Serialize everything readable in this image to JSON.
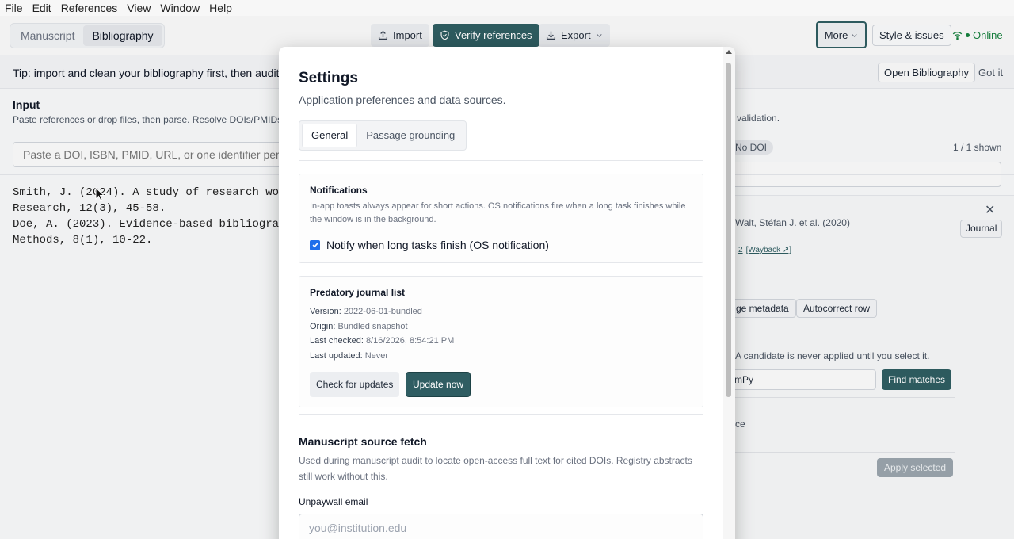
{
  "menu": [
    "File",
    "Edit",
    "References",
    "View",
    "Window",
    "Help"
  ],
  "toolbar": {
    "tabs": [
      {
        "label": "Manuscript"
      },
      {
        "label": "Bibliography"
      }
    ],
    "import_label": "Import",
    "verify_label": "Verify references",
    "export_label": "Export",
    "more_label": "More",
    "style_label": "Style & issues",
    "status_label": "Online",
    "status_color": "#15803d"
  },
  "tip": {
    "text": "Tip: import and clean your bibliography first, then audit",
    "open_label": "Open Bibliography",
    "dismiss_label": "Got it"
  },
  "input": {
    "title": "Input",
    "subtitle": "Paste references or drop files, then parse. Resolve DOIs/PMIDs",
    "subtitle_right": "validation.",
    "placeholder": "Paste a DOI, ISBN, PMID, URL, or one identifier per",
    "references": "Smith, J. (2024). A study of research wo\nResearch, 12(3), 45-58.\nDoe, A. (2023). Evidence-based bibliogra\nMethods, 8(1), 10-22."
  },
  "right_panel": {
    "badge": "No DOI",
    "count": "1 / 1 shown",
    "author": "Walt, Stéfan J. et al. (2020)",
    "journal_badge": "Journal",
    "link_partial": "2",
    "wayback": "[Wayback ↗]",
    "merge_btn": "ge metadata",
    "autocorrect_btn": "Autocorrect row",
    "note": "A candidate is never applied until you select it.",
    "search_value": "mPy",
    "find_btn": "Find matches",
    "ce_text": "ce",
    "apply_btn": "Apply selected"
  },
  "modal": {
    "title": "Settings",
    "subtitle": "Application preferences and data sources.",
    "tabs": [
      {
        "label": "General"
      },
      {
        "label": "Passage grounding"
      }
    ],
    "notifications": {
      "title": "Notifications",
      "text": "In-app toasts always appear for short actions. OS notifications fire when a long task finishes while the window is in the background.",
      "checkbox_label": "Notify when long tasks finish (OS notification)",
      "checked": true
    },
    "predatory": {
      "title": "Predatory journal list",
      "version_label": "Version:",
      "version": "2022-06-01-bundled",
      "origin_label": "Origin:",
      "origin": "Bundled snapshot",
      "checked_label": "Last checked:",
      "checked": "8/16/2026, 8:54:21 PM",
      "updated_label": "Last updated:",
      "updated": "Never",
      "check_btn": "Check for updates",
      "update_btn": "Update now"
    },
    "source_fetch": {
      "title": "Manuscript source fetch",
      "text": "Used during manuscript audit to locate open-access full text for cited DOIs. Registry abstracts still work without this.",
      "email_label": "Unpaywall email",
      "email_placeholder": "you@institution.edu"
    }
  },
  "accent_color": "#2f5d62"
}
